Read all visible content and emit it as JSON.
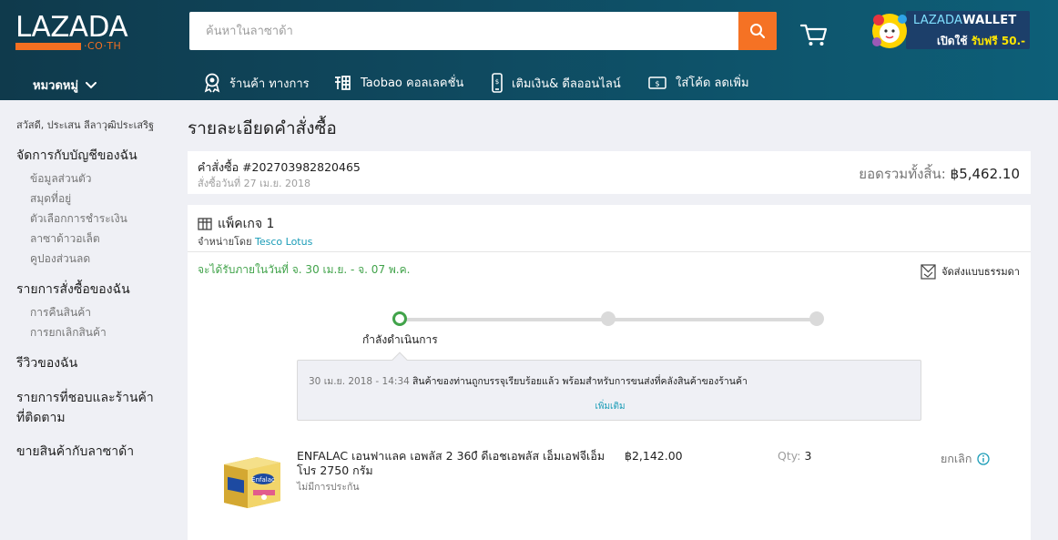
{
  "header": {
    "logo_text": "LAZADA",
    "logo_sub": "·CO·TH",
    "search_placeholder": "ค้นหาในลาซาด้า",
    "wallet_title_a": "LAZADA",
    "wallet_title_b": "WALLET",
    "wallet_sub_a": "เปิดใช้",
    "wallet_sub_b": "รับฟรี 50.-"
  },
  "nav": {
    "category": "หมวดหมู่",
    "items": [
      {
        "label": "ร้านค้า ทางการ",
        "icon": "official-store-icon"
      },
      {
        "label": "Taobao คอลเลคชั่น",
        "icon": "taobao-icon"
      },
      {
        "label": "เติมเงิน& ดีลออนไลน์",
        "icon": "mobile-topup-icon"
      },
      {
        "label": "ใส่โค้ด ลดเพิ่ม",
        "icon": "voucher-icon"
      }
    ]
  },
  "sidebar": {
    "greeting": "สวัสดี, ประเสน ลีลาวุฒิประเสริฐ",
    "account_heading": "จัดการกับบัญชีของฉัน",
    "account_items": [
      "ข้อมูลส่วนตัว",
      "สมุดที่อยู่",
      "ตัวเลือกการชำระเงิน",
      "ลาซาด้าวอเล็ต",
      "คูปองส่วนลด"
    ],
    "orders_heading": "รายการสั่งซื้อของฉัน",
    "orders_items": [
      "การคืนสินค้า",
      "การยกเลิกสินค้า"
    ],
    "reviews": "รีวิวของฉัน",
    "wishlist_line1": "รายการที่ชอบและร้านค้า",
    "wishlist_line2": "ที่ติดตาม",
    "sell": "ขายสินค้ากับลาซาด้า"
  },
  "page_title": "รายละเอียดคำสั่งซื้อ",
  "order": {
    "number": "คำสั่งซื้อ #202703982820465",
    "date": "สั่งซื้อวันที่ 27 เม.ย. 2018",
    "total_label": "ยอดรวมทั้งสิ้น:",
    "total_value": "฿5,462.10"
  },
  "package": {
    "title": "แพ็คเกจ 1",
    "seller_prefix": "จำหน่ายโดย",
    "seller_name": "Tesco Lotus",
    "delivery_estimate": "จะได้รับภายในวันที่ จ. 30 เม.ย. - จ. 07 พ.ค.",
    "shipping_method": "จัดส่งแบบธรรมดา",
    "current_step": "กำลังดำเนินการ",
    "log_time": "30 เม.ย. 2018 - 14:34",
    "log_text": "สินค้าของท่านถูกบรรจุเรียบร้อยแล้ว พร้อมสำหรับการขนส่งที่คลังสินค้าของร้านค้า",
    "log_more": "เพิ่มเติม"
  },
  "product": {
    "name": "ENFALAC เอนฟาแลค เอพลัส 2 360ํ ดีเอชเอพลัส เอ็มเอฟจีเอ็ม โปร 2750 กรัม",
    "warranty": "ไม่มีการประกัน",
    "price": "฿2,142.00",
    "qty_label": "Qty:",
    "qty_value": "3",
    "cancel_label": "ยกเลิก",
    "image_label": "Enfalac"
  },
  "colors": {
    "header_bg": "#0f4a60",
    "search_button": "#f57224",
    "success_green": "#41a34a",
    "link_blue": "#1a9cb7"
  }
}
